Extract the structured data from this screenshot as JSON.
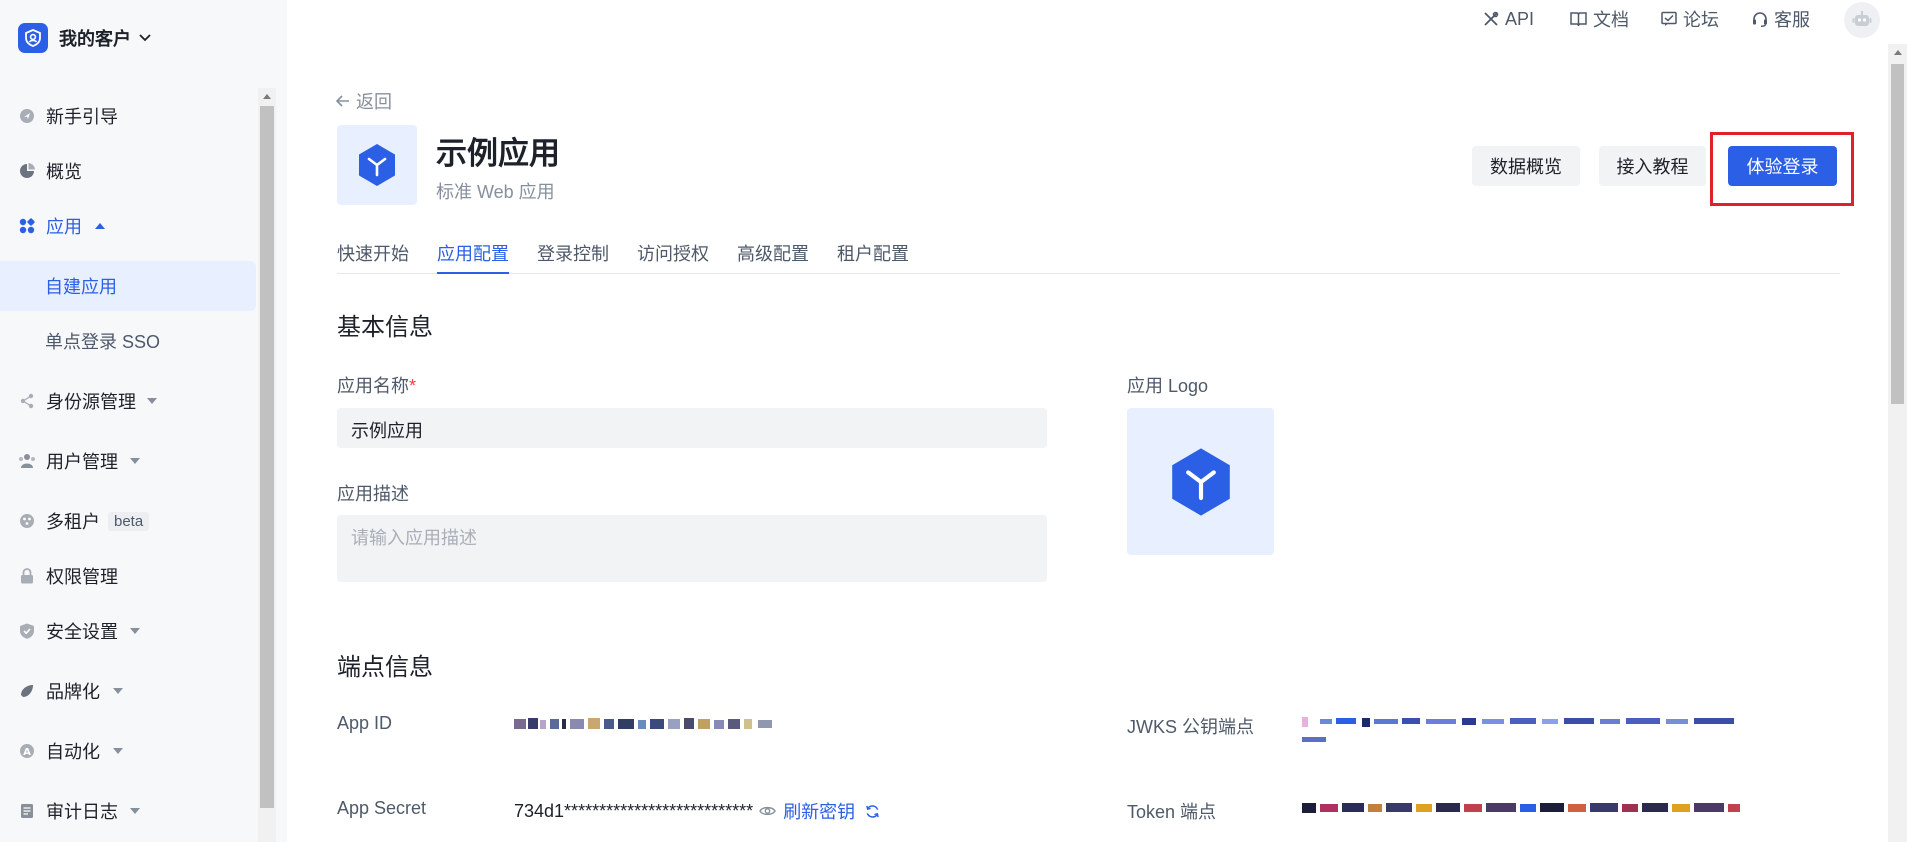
{
  "org": {
    "name": "我的客户"
  },
  "sidebar": {
    "items": [
      {
        "label": "新手引导",
        "icon": "guide-icon"
      },
      {
        "label": "概览",
        "icon": "pie-chart-icon"
      },
      {
        "label": "应用",
        "icon": "apps-icon",
        "expanded": true
      },
      {
        "label": "自建应用",
        "sub": true,
        "active": true
      },
      {
        "label": "单点登录 SSO",
        "sub": true
      },
      {
        "label": "身份源管理",
        "icon": "share-icon"
      },
      {
        "label": "用户管理",
        "icon": "users-icon"
      },
      {
        "label": "多租户",
        "icon": "tenant-icon",
        "tag": "beta"
      },
      {
        "label": "权限管理",
        "icon": "lock-icon"
      },
      {
        "label": "安全设置",
        "icon": "shield-icon"
      },
      {
        "label": "品牌化",
        "icon": "brand-icon"
      },
      {
        "label": "自动化",
        "icon": "automation-icon"
      },
      {
        "label": "审计日志",
        "icon": "log-icon"
      }
    ]
  },
  "topbar": {
    "api": "API",
    "docs": "文档",
    "forum": "论坛",
    "support": "客服"
  },
  "page": {
    "back": "返回",
    "app_name": "示例应用",
    "app_type": "标准 Web 应用",
    "buttons": {
      "overview": "数据概览",
      "tutorial": "接入教程",
      "try_login": "体验登录"
    },
    "tabs": [
      "快速开始",
      "应用配置",
      "登录控制",
      "访问授权",
      "高级配置",
      "租户配置"
    ],
    "active_tab": "应用配置"
  },
  "basic_info": {
    "title": "基本信息",
    "name_label": "应用名称",
    "name_required": "*",
    "name_value": "示例应用",
    "desc_label": "应用描述",
    "desc_placeholder": "请输入应用描述",
    "logo_label": "应用 Logo"
  },
  "endpoints": {
    "title": "端点信息",
    "app_id_label": "App ID",
    "app_secret_label": "App Secret",
    "app_secret_value": "734d1***************************",
    "refresh_secret": "刷新密钥",
    "jwks_label": "JWKS 公钥端点",
    "token_label": "Token 端点"
  },
  "colors": {
    "primary": "#2b5fe6",
    "highlight": "#e0202b",
    "required": "#f53f3f"
  }
}
